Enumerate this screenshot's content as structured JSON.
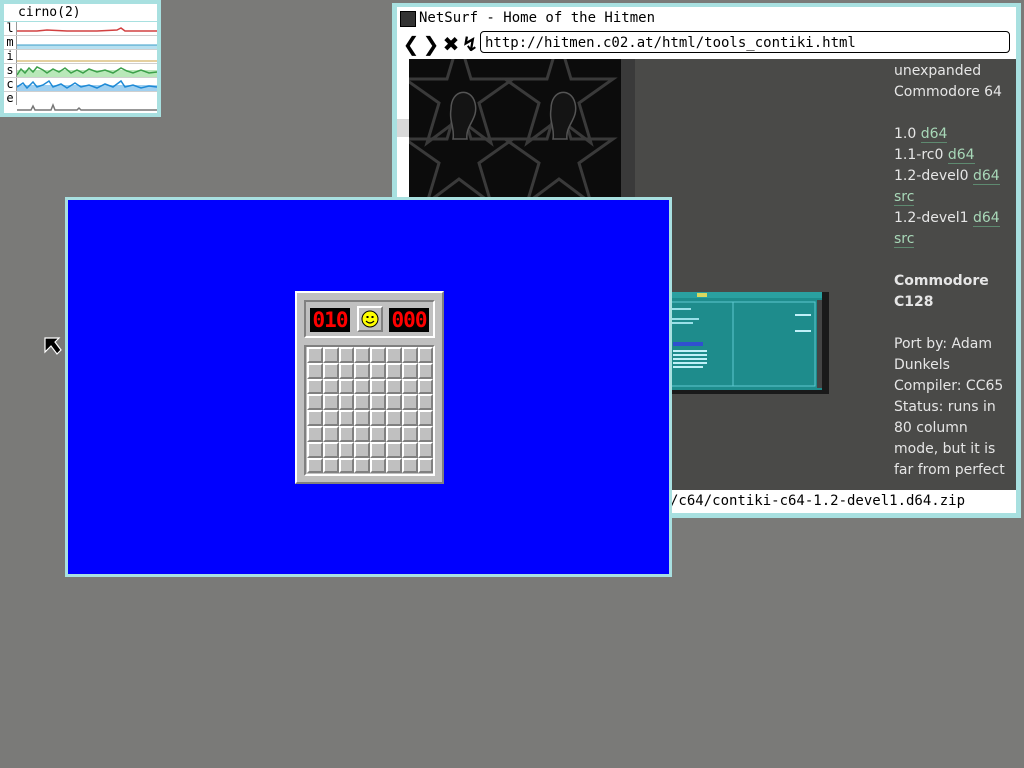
{
  "stats_window": {
    "title": "cirno(2)",
    "rows": [
      {
        "label": "l",
        "color": "#d24040"
      },
      {
        "label": "m",
        "color": "#3a9ec8"
      },
      {
        "label": "i",
        "color": "#c8a040"
      },
      {
        "label": "s",
        "color": "#3ca04a"
      },
      {
        "label": "c",
        "color": "#1e8ad6"
      },
      {
        "label": "e",
        "color": "#777777"
      }
    ]
  },
  "browser": {
    "title": "NetSurf - Home of the Hitmen",
    "icons": {
      "back": "back-icon",
      "forward": "forward-icon",
      "stop": "stop-icon",
      "reload": "reload-icon"
    },
    "back_glyph": "❮",
    "forward_glyph": "❯",
    "stop_glyph": "✖",
    "reload_glyph": "↯",
    "url": "http://hitmen.c02.at/html/tools_contiki.html",
    "status": "/c64/contiki-c64-1.2-devel1.d64.zip",
    "sidebar": {
      "line1": "unexpanded",
      "line2": "Commodore 64",
      "releases": [
        {
          "version": "1.0",
          "links": [
            "d64"
          ]
        },
        {
          "version": "1.1-rc0",
          "links": [
            "d64"
          ]
        },
        {
          "version": "1.2-devel0",
          "links": [
            "d64",
            "src"
          ]
        },
        {
          "version": "1.2-devel1",
          "links": [
            "d64",
            "src"
          ]
        }
      ],
      "heading1": "Commodore",
      "heading2": "C128",
      "port_by": "Port by: Adam",
      "port_by2": "Dunkels",
      "compiler": "Compiler: CC65",
      "status1": "Status: runs in",
      "status2": "80 column",
      "status3": "mode, but it is",
      "status4": "far from perfect"
    }
  },
  "minesweeper": {
    "mine_counter": "010",
    "timer": "000",
    "face_icon": "smiley-face-icon",
    "rows": 8,
    "cols": 8,
    "background_color": "#0000ff"
  }
}
